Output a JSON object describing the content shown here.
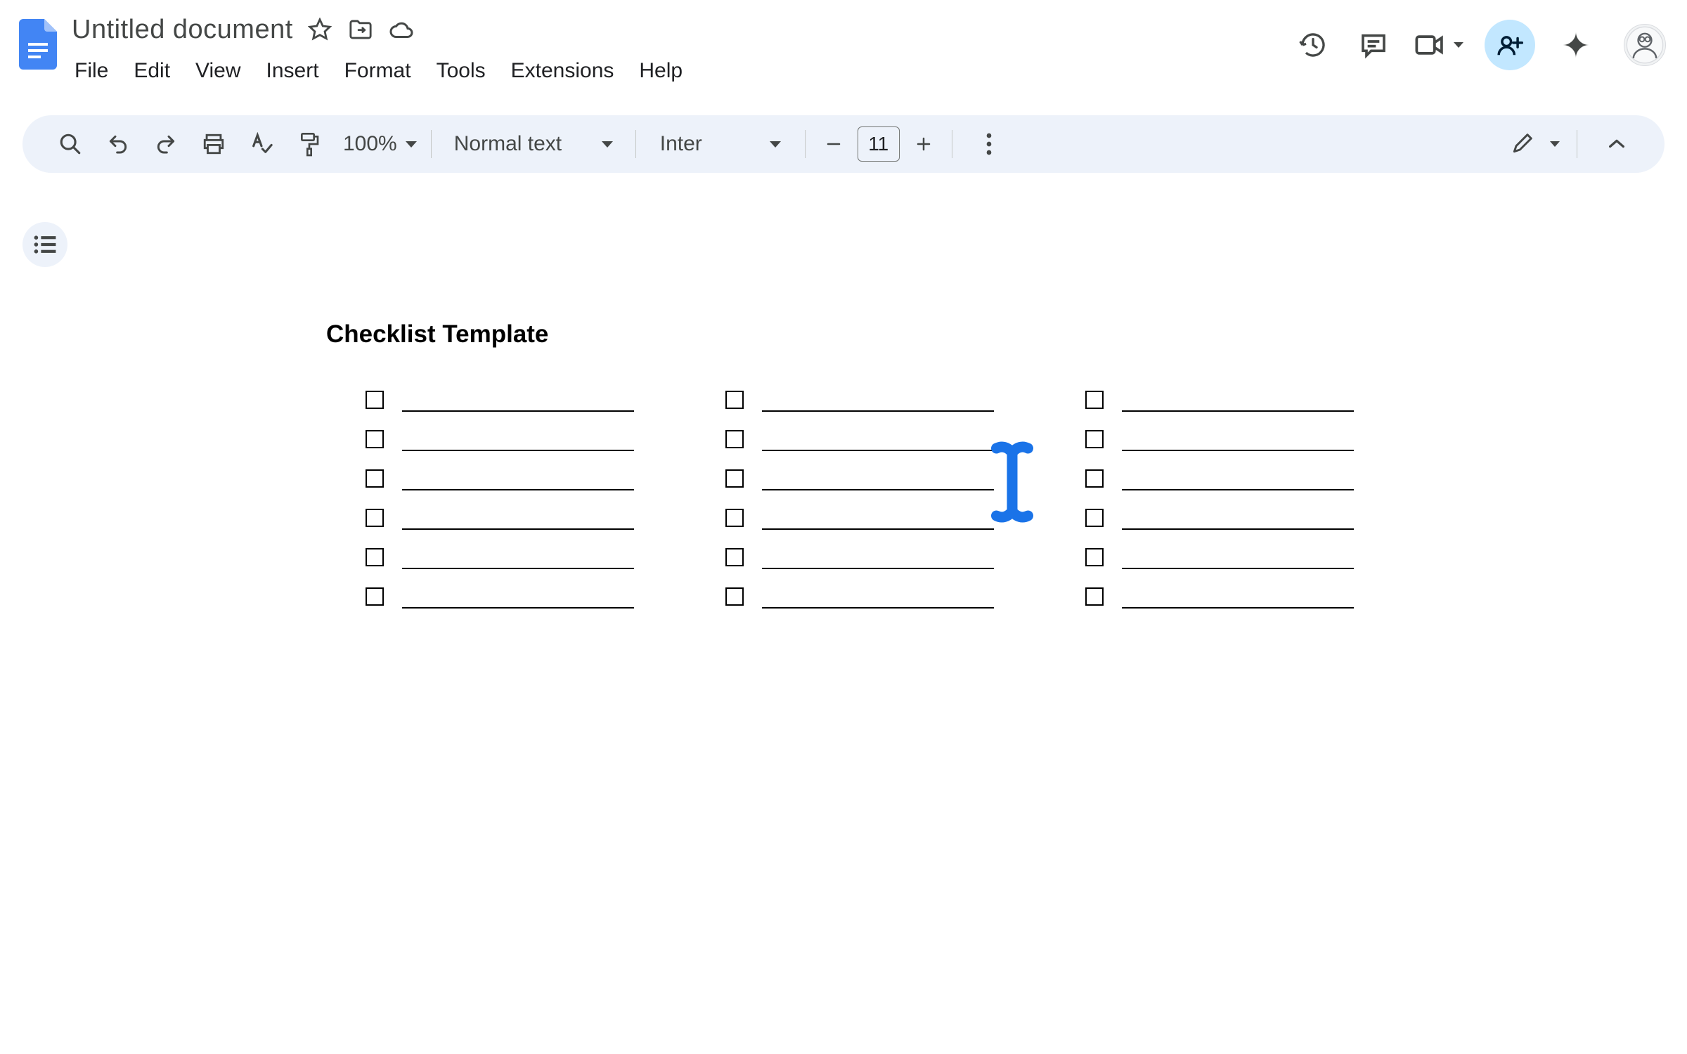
{
  "doc": {
    "title": "Untitled document",
    "heading": "Checklist Template"
  },
  "menu": {
    "file": "File",
    "edit": "Edit",
    "view": "View",
    "insert": "Insert",
    "format": "Format",
    "tools": "Tools",
    "extensions": "Extensions",
    "help": "Help"
  },
  "toolbar": {
    "zoom": "100%",
    "style": "Normal text",
    "font": "Inter",
    "font_size": "11"
  },
  "checklist": {
    "columns": 3,
    "rows_per_column": 6
  },
  "colors": {
    "toolbar_bg": "#edf2fa",
    "share_bg": "#c2e7ff",
    "accent": "#1a73e8",
    "doc_icon": "#4285f4"
  }
}
